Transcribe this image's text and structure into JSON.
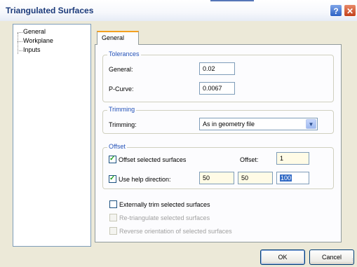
{
  "window": {
    "title": "Triangulated Surfaces"
  },
  "titlebar": {
    "help_glyph": "?",
    "close_glyph": "✕"
  },
  "tree": {
    "items": [
      "General",
      "Workplane",
      "Inputs"
    ]
  },
  "tab": {
    "label": "General"
  },
  "tolerances": {
    "title": "Tolerances",
    "general_label": "General:",
    "general_value": "0.02",
    "pcurve_label": "P-Curve:",
    "pcurve_value": "0.0067"
  },
  "trimming": {
    "title": "Trimming",
    "label": "Trimming:",
    "value": "As in geometry file"
  },
  "offset": {
    "title": "Offset",
    "offset_selected_label": "Offset selected surfaces",
    "offset_selected_checked": true,
    "offset_label": "Offset:",
    "offset_value": "1",
    "use_help_label": "Use help direction:",
    "use_help_checked": true,
    "dir_x": "50",
    "dir_y": "50",
    "dir_z": "100"
  },
  "options": {
    "externally_trim": "Externally trim selected surfaces",
    "retriangulate": "Re-triangulate selected surfaces",
    "reverse": "Reverse orientation of selected surfaces"
  },
  "buttons": {
    "ok": "OK",
    "cancel": "Cancel"
  },
  "colors": {
    "group_title": "#2452b8",
    "tab_accent": "#f4a020",
    "selection": "#316ac5"
  }
}
